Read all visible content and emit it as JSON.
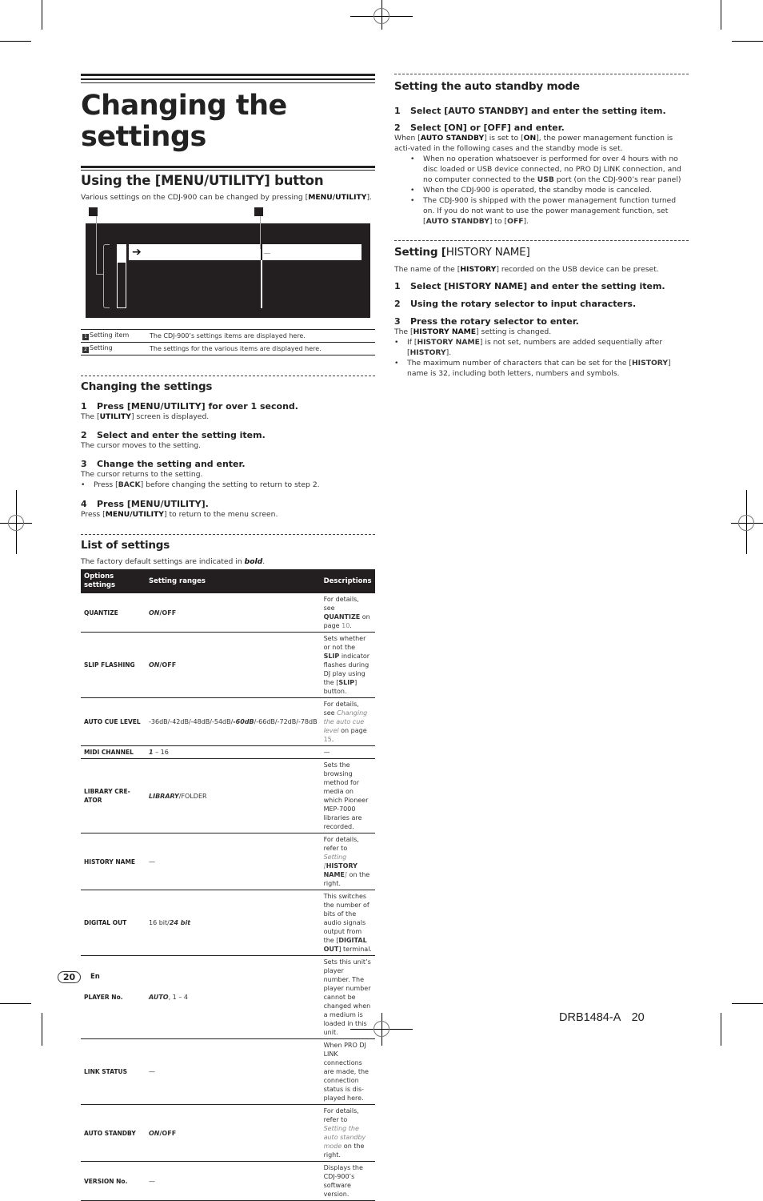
{
  "page": {
    "title_line1": "Changing the",
    "title_line2": "settings",
    "page_number": "20",
    "language": "En",
    "doc_id": "DRB1484-A",
    "doc_page": "20"
  },
  "menu_utility": {
    "heading": "Using the [MENU/UTILITY] button",
    "intro_pre": "Various settings on the CDJ-900 can be changed by pressing [",
    "intro_bold": "MENU/UTILITY",
    "intro_post": "].",
    "diagram": {
      "callout_1": "1",
      "callout_2": "2",
      "cursor_arrow": "➔"
    },
    "legend": [
      {
        "num": "1",
        "label": "Setting item",
        "desc": "The CDJ-900’s settings items are displayed here."
      },
      {
        "num": "2",
        "label": "Setting",
        "desc": "The settings for the various items are displayed here."
      }
    ]
  },
  "changing": {
    "heading": "Changing the settings",
    "steps": [
      {
        "num": "1",
        "title": "Press [MENU/UTILITY] for over 1 second.",
        "desc_pre": "The [",
        "desc_bold": "UTILITY",
        "desc_post": "] screen is displayed."
      },
      {
        "num": "2",
        "title": "Select and enter the setting item.",
        "desc": "The cursor moves to the setting."
      },
      {
        "num": "3",
        "title": "Change the setting and enter.",
        "desc": "The cursor returns to the setting.",
        "bullet_pre": "Press [",
        "bullet_bold": "BACK",
        "bullet_post": "] before changing the setting to return to step 2."
      },
      {
        "num": "4",
        "title": "Press [MENU/UTILITY].",
        "desc_pre": "Press [",
        "desc_bold": "MENU/UTILITY",
        "desc_post": "] to return to the menu screen."
      }
    ]
  },
  "list": {
    "heading": "List of settings",
    "intro_pre": "The factory default settings are indicated in ",
    "intro_bold": "bold",
    "intro_post": ".",
    "columns": [
      "Options settings",
      "Setting ranges",
      "Descriptions"
    ],
    "rows": [
      {
        "option": "QUANTIZE",
        "range_bold": "ON",
        "range_rest": "/OFF",
        "desc_pre": "For details, see ",
        "desc_bold": "QUANTIZE",
        "desc_mid": " on page ",
        "desc_page": "10",
        "desc_post": "."
      },
      {
        "option": "SLIP FLASHING",
        "range_bold": "ON",
        "range_rest": "/OFF",
        "desc_pre": "Sets whether or not the ",
        "desc_bold": "SLIP",
        "desc_mid": " indicator flashes during DJ play using the [",
        "desc_bold2": "SLIP",
        "desc_post": "] button."
      },
      {
        "option": "AUTO CUE LEVEL",
        "range_pre": "-36dB/-42dB/-48dB/-54dB/",
        "range_bold": "-60dB",
        "range_rest": "/-66dB/-72dB/-78dB",
        "desc_pre": "For details, see ",
        "desc_link": "Changing the auto cue level",
        "desc_mid": " on page ",
        "desc_page": "15",
        "desc_post": "."
      },
      {
        "option": "MIDI CHANNEL",
        "range_bold": "1",
        "range_rest": " – 16",
        "desc": "—"
      },
      {
        "option": "LIBRARY CRE-ATOR",
        "range_bold": "LIBRARY",
        "range_rest": "/FOLDER",
        "desc": "Sets the browsing method for media on which Pioneer MEP-7000 libraries are recorded."
      },
      {
        "option": "HISTORY NAME",
        "range_rest": "—",
        "desc_pre": "For details, refer to ",
        "desc_link": "Setting [",
        "desc_bold": "HISTORY NAME",
        "desc_link2": "]",
        "desc_post": " on the right."
      },
      {
        "option": "DIGITAL OUT",
        "range_pre": "16 bit/",
        "range_bold": "24 bit",
        "desc_pre": "This switches the number of bits of the audio signals output from the [",
        "desc_bold": "DIGITAL OUT",
        "desc_post": "] terminal."
      },
      {
        "option": "PLAYER No.",
        "range_bold": "AUTO",
        "range_rest": ", 1 – 4",
        "desc": "Sets this unit’s player number. The player number cannot be changed when a medium is loaded in this unit."
      },
      {
        "option": "LINK STATUS",
        "range_rest": "—",
        "desc": "When PRO DJ LINK connections are made, the connection status is dis-played here."
      },
      {
        "option": "AUTO STANDBY",
        "range_bold": "ON",
        "range_rest": "/OFF",
        "desc_pre": "For details, refer to ",
        "desc_link": "Setting the auto standby mode",
        "desc_post": " on the right."
      },
      {
        "option": "VERSION No.",
        "range_rest": "—",
        "desc": "Displays the CDJ-900’s software version."
      }
    ]
  },
  "auto_standby": {
    "heading": "Setting the auto standby mode",
    "step1": {
      "num": "1",
      "title": "Select [AUTO STANDBY] and enter the setting item."
    },
    "step2": {
      "num": "2",
      "title": "Select [ON] or [OFF] and enter."
    },
    "desc_pre": "When [",
    "desc_bold1": "AUTO STANDBY",
    "desc_mid": "] is set to [",
    "desc_bold2": "ON",
    "desc_post": "], the power management function is acti-vated in the following cases and the standby mode is set.",
    "bullets": [
      {
        "pre": "When no operation whatsoever is performed for over 4 hours with no disc loaded or USB device connected, no PRO DJ LINK connection, and no computer connected to the ",
        "bold": "USB",
        "post": " port (on the CDJ-900’s rear panel)"
      },
      {
        "pre": "When the CDJ-900 is operated, the standby mode is canceled."
      },
      {
        "pre": "The CDJ-900 is shipped with the power management function turned on. If you do not want to use the power management function, set [",
        "bold": "AUTO STANDBY",
        "mid": "] to [",
        "bold2": "OFF",
        "post": "]."
      }
    ]
  },
  "history_name": {
    "heading_bold": "Setting [",
    "heading_rest": "HISTORY NAME]",
    "intro_pre": "The name of the [",
    "intro_bold": "HISTORY",
    "intro_post": "] recorded on the USB device can be preset.",
    "steps": [
      {
        "num": "1",
        "title": "Select [HISTORY NAME] and enter the setting item."
      },
      {
        "num": "2",
        "title": "Using the rotary selector to input characters."
      },
      {
        "num": "3",
        "title": "Press the rotary selector to enter."
      }
    ],
    "desc_pre": "The [",
    "desc_bold": "HISTORY NAME",
    "desc_post": "] setting is changed.",
    "bullets": [
      {
        "pre": "If [",
        "bold": "HISTORY NAME",
        "mid": "] is not set, numbers are added sequentially after [",
        "bold2": "HISTORY",
        "post": "]."
      },
      {
        "pre": "The maximum number of characters that can be set for the [",
        "bold": "HISTORY",
        "post": "] name is 32, including both letters, numbers and symbols."
      }
    ]
  }
}
